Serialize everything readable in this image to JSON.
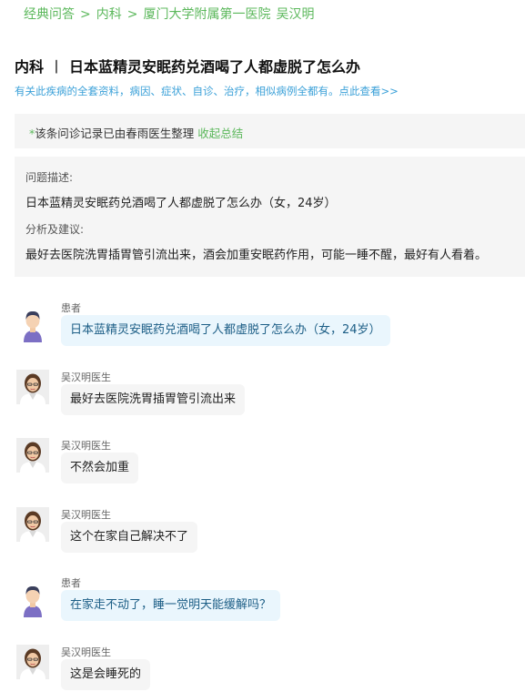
{
  "breadcrumb": {
    "items": [
      "经典问答",
      "内科",
      "厦门大学附属第一医院"
    ],
    "separator": ">",
    "doctor": "吴汉明"
  },
  "page": {
    "department": "内科",
    "divider": "丨",
    "title": "日本蓝精灵安眠药兑酒喝了人都虚脱了怎么办",
    "promo": "有关此疾病的全套资料，病因、症状、自诊、治疗，相似病例全都有。点此查看>>"
  },
  "note": {
    "star": "*",
    "text": "该条问诊记录已由春雨医生整理",
    "collapse": "收起总结"
  },
  "summary": {
    "problem_label": "问题描述:",
    "problem_text": "日本蓝精灵安眠药兑酒喝了人都虚脱了怎么办（女，24岁）",
    "advice_label": "分析及建议:",
    "advice_text": "最好去医院洗胃插胃管引流出来，酒会加重安眠药作用，可能一睡不醒，最好有人看着。"
  },
  "messages": [
    {
      "role": "patient",
      "name": "患者",
      "text": "日本蓝精灵安眠药兑酒喝了人都虚脱了怎么办（女，24岁）"
    },
    {
      "role": "doctor",
      "name": "吴汉明医生",
      "text": "最好去医院洗胃插胃管引流出来"
    },
    {
      "role": "doctor",
      "name": "吴汉明医生",
      "text": "不然会加重"
    },
    {
      "role": "doctor",
      "name": "吴汉明医生",
      "text": "这个在家自己解决不了"
    },
    {
      "role": "patient",
      "name": "患者",
      "text": "在家走不动了，睡一觉明天能缓解吗？"
    },
    {
      "role": "doctor",
      "name": "吴汉明医生",
      "text": "这是会睡死的"
    }
  ],
  "colors": {
    "accent_green": "#5cb85c",
    "link_blue": "#3aa0d8",
    "patient_bubble": "#eaf6fd",
    "doctor_bubble": "#f5f5f5"
  },
  "icons": {
    "patient": "patient-avatar-icon",
    "doctor": "doctor-avatar-icon"
  }
}
